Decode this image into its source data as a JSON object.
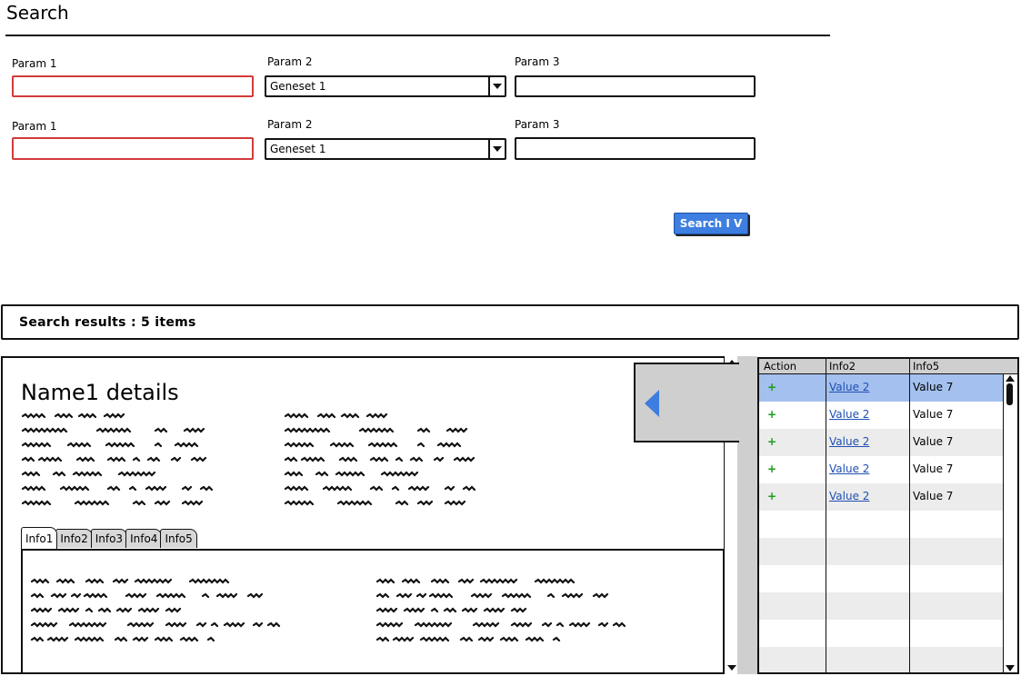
{
  "page": {
    "title": "Search"
  },
  "form": {
    "rows": [
      {
        "param1_label": "Param 1",
        "param2_label": "Param 2",
        "param2_value": "Geneset 1",
        "param3_label": "Param 3"
      },
      {
        "param1_label": "Param 1",
        "param2_label": "Param 2",
        "param2_value": "Geneset 1",
        "param3_label": "Param 3"
      }
    ],
    "search_button": "Search I V"
  },
  "results": {
    "summary": "Search results : 5 items"
  },
  "details": {
    "title": "Name1 details",
    "tabs": [
      "Info1",
      "Info2",
      "Info3",
      "Info4",
      "Info5"
    ],
    "active_tab": "Info1"
  },
  "grid": {
    "columns": [
      "Action",
      "Info2",
      "Info5"
    ],
    "rows": [
      {
        "action": "+",
        "info2": "Value 2",
        "info5": "Value 7",
        "selected": true
      },
      {
        "action": "+",
        "info2": "Value 2",
        "info5": "Value 7",
        "selected": false
      },
      {
        "action": "+",
        "info2": "Value 2",
        "info5": "Value 7",
        "selected": false
      },
      {
        "action": "+",
        "info2": "Value 2",
        "info5": "Value 7",
        "selected": false
      },
      {
        "action": "+",
        "info2": "Value 2",
        "info5": "Value 7",
        "selected": false
      }
    ]
  },
  "colors": {
    "accent": "#3d7ee0",
    "invalid_border": "#d23b3b",
    "selected_row": "#a3c0ee",
    "link": "#1f4fb3",
    "action_plus": "#1a9d1a",
    "collapse_arrow": "#3d7ee0"
  },
  "icons": {
    "select_arrow": "triangle-down",
    "collapse": "triangle-left",
    "scroll_up": "triangle-up",
    "scroll_down": "triangle-down"
  }
}
